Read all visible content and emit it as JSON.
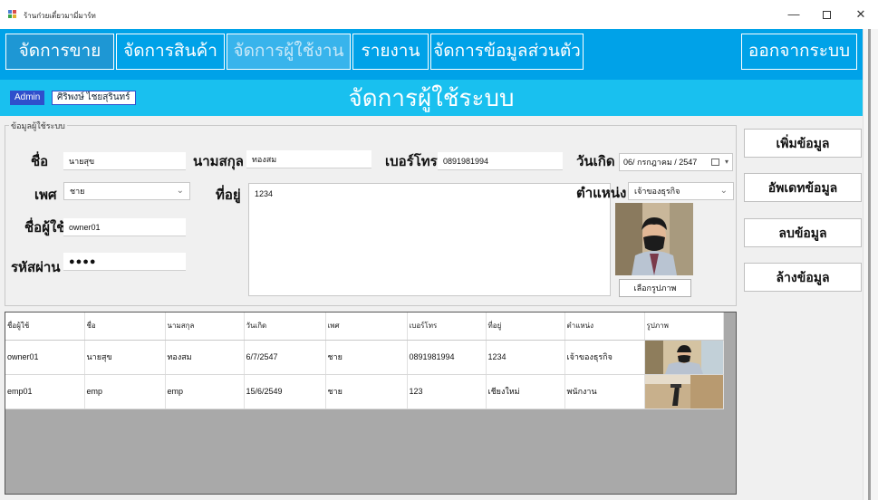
{
  "window": {
    "title": "ร้านก๋วยเตี๋ยวมามี่มาร์ท",
    "minimize_glyph": "—",
    "close_glyph": "✕"
  },
  "menu": {
    "sales": "จัดการขาย",
    "products": "จัดการสินค้า",
    "users": "จัดการผู้ใช้งาน",
    "report": "รายงาน",
    "profile": "จัดการข้อมูลส่วนตัว",
    "logout": "ออกจากระบบ"
  },
  "header": {
    "role_badge": "Admin",
    "user_name": "ศิริพงษ์ ไชยสุรินทร์",
    "title": "จัดการผู้ใช้ระบบ"
  },
  "form": {
    "group_title": "ข้อมูลผู้ใช้ระบบ",
    "labels": {
      "first_name": "ชื่อ",
      "last_name": "นามสกุล",
      "phone": "เบอร์โทร",
      "birthdate": "วันเกิด",
      "gender": "เพศ",
      "address": "ที่อยู่",
      "position": "ตำแหน่ง",
      "username": "ชื่อผู้ใช้",
      "password": "รหัสผ่าน"
    },
    "values": {
      "first_name": "นายสุข",
      "last_name": "ทองสม",
      "phone": "0891981994",
      "birthdate": "06/ กรกฎาคม  / 2547",
      "gender": "ชาย",
      "address": "1234",
      "position": "เจ้าของธุรกิจ",
      "username": "owner01",
      "password": "●●●●"
    },
    "choose_image_button": "เลือกรูปภาพ"
  },
  "actions": {
    "add": "เพิ่มข้อมูล",
    "update": "อัพเดทข้อมูล",
    "delete": "ลบข้อมูล",
    "clear": "ล้างข้อมูล"
  },
  "grid": {
    "columns": [
      "ชื่อผู้ใช้",
      "ชื่อ",
      "นามสกุล",
      "วันเกิด",
      "เพศ",
      "เบอร์โทร",
      "ที่อยู่",
      "ตำแหน่ง",
      "รูปภาพ"
    ],
    "rows": [
      [
        "owner01",
        "นายสุข",
        "ทองสม",
        "6/7/2547",
        "ชาย",
        "0891981994",
        "1234",
        "เจ้าของธุรกิจ",
        "photo-man-mask"
      ],
      [
        "emp01",
        "emp",
        "emp",
        "15/6/2549",
        "ชาย",
        "123",
        "เชียงใหม่",
        "พนักงาน",
        "photo-room"
      ]
    ]
  },
  "colors": {
    "menu_bg": "#00a2e8",
    "header_bg": "#19c0ef",
    "role_badge_bg": "#2f4fcc"
  }
}
